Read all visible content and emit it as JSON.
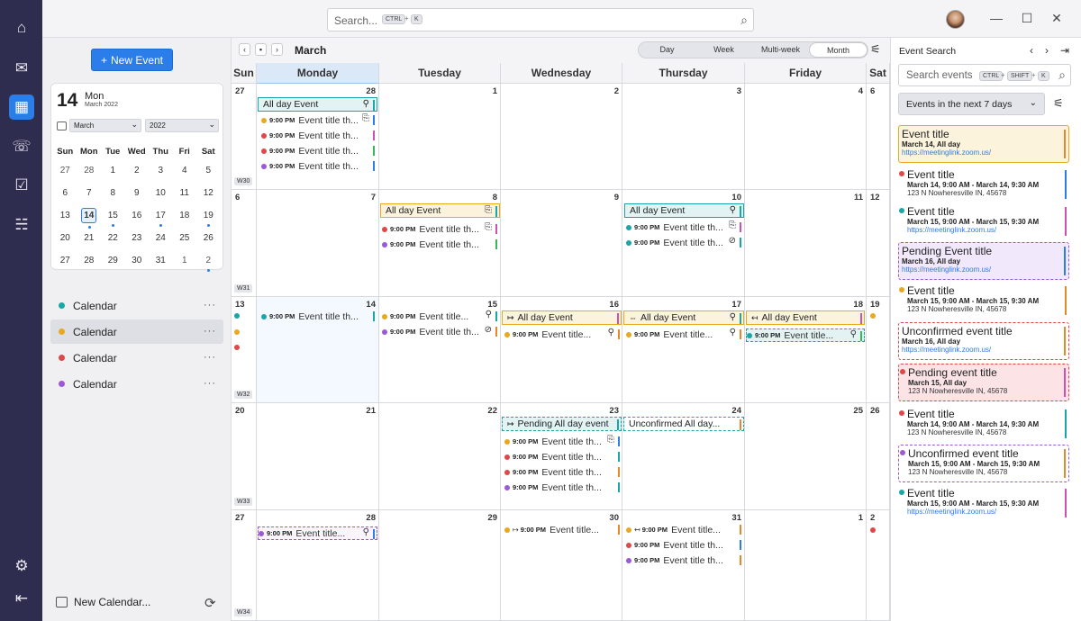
{
  "search": {
    "placeholder": "Search...",
    "key1": "CTRL",
    "plus": "+",
    "key2": "K"
  },
  "sidebar": {
    "new_event": "New Event",
    "today_num": "14",
    "today_name": "Mon",
    "today_sub": "March 2022",
    "month_sel": "March",
    "year_sel": "2022",
    "weekdays": [
      "Sun",
      "Mon",
      "Tue",
      "Wed",
      "Thu",
      "Fri",
      "Sat"
    ],
    "weeks": [
      [
        "27",
        "28",
        "1",
        "2",
        "3",
        "4",
        "5"
      ],
      [
        "6",
        "7",
        "8",
        "9",
        "10",
        "11",
        "12"
      ],
      [
        "13",
        "14",
        "15",
        "16",
        "17",
        "18",
        "19"
      ],
      [
        "20",
        "21",
        "22",
        "23",
        "24",
        "25",
        "26"
      ],
      [
        "27",
        "28",
        "29",
        "30",
        "31",
        "1",
        "2"
      ]
    ],
    "calendars": [
      {
        "label": "Calendar",
        "color": "#1aa6a6"
      },
      {
        "label": "Calendar",
        "color": "#e8a820"
      },
      {
        "label": "Calendar",
        "color": "#e04848"
      },
      {
        "label": "Calendar",
        "color": "#9b59d6"
      }
    ],
    "more": "···",
    "new_calendar": "New Calendar..."
  },
  "toolbar": {
    "month_title": "March",
    "views": [
      "Day",
      "Week",
      "Multi-week",
      "Month"
    ]
  },
  "grid": {
    "day_headers": [
      "Sun",
      "Monday",
      "Tuesday",
      "Wednesday",
      "Thursday",
      "Friday",
      "Sat"
    ],
    "weeks": [
      {
        "label": "W30",
        "days": [
          "27",
          "28",
          "1",
          "2",
          "3",
          "4",
          "6"
        ]
      },
      {
        "label": "W31",
        "days": [
          "6",
          "7",
          "8",
          "9",
          "10",
          "11",
          "12"
        ]
      },
      {
        "label": "W32",
        "days": [
          "13",
          "14",
          "15",
          "16",
          "17",
          "18",
          "19"
        ]
      },
      {
        "label": "W33",
        "days": [
          "20",
          "21",
          "22",
          "23",
          "24",
          "25",
          "26"
        ]
      },
      {
        "label": "W34",
        "days": [
          "27",
          "28",
          "29",
          "30",
          "31",
          "1",
          "2"
        ]
      }
    ],
    "allday": "All day Event",
    "time": "9:00 PM",
    "evt_title": "Event title th...",
    "evt_title2": "Event title...",
    "pending_allday": "Pending All day event",
    "unconfirmed_allday": "Unconfirmed All day..."
  },
  "right": {
    "title": "Event Search",
    "placeholder": "Search events",
    "k1": "CTRL",
    "k2": "SHIFT",
    "k3": "K",
    "filter": "Events in the next 7 days",
    "items": [
      {
        "title": "Event title",
        "date": "March 14, All day",
        "link": "https://meetinglink.zoom.us/"
      },
      {
        "title": "Event title",
        "date": "March 14, 9:00 AM - March 14, 9:30 AM",
        "addr": "123 N Nowheresville IN, 45678"
      },
      {
        "title": "Event title",
        "date": "March 15, 9:00 AM - March 15, 9:30 AM",
        "link": "https://meetinglink.zoom.us/"
      },
      {
        "title": "Pending Event title",
        "date": "March 16, All day",
        "link": "https://meetinglink.zoom.us/"
      },
      {
        "title": "Event title",
        "date": "March 15, 9:00 AM - March 15, 9:30 AM",
        "addr": "123 N Nowheresville IN, 45678"
      },
      {
        "title": "Unconfirmed event title",
        "date": "March 16, All day",
        "link": "https://meetinglink.zoom.us/"
      },
      {
        "title": "Pending event title",
        "date": "March 15, All day",
        "addr": "123 N Nowheresville IN, 45678"
      },
      {
        "title": "Event title",
        "date": "March 14, 9:00 AM - March 14, 9:30 AM",
        "addr": "123 N Nowheresville IN, 45678"
      },
      {
        "title": "Unconfirmed event title",
        "date": "March 15, 9:00 AM - March 15, 9:30 AM",
        "addr": "123 N Nowheresville IN, 45678"
      },
      {
        "title": "Event title",
        "date": "March 15, 9:00 AM - March 15, 9:30 AM",
        "link": "https://meetinglink.zoom.us/"
      }
    ]
  }
}
